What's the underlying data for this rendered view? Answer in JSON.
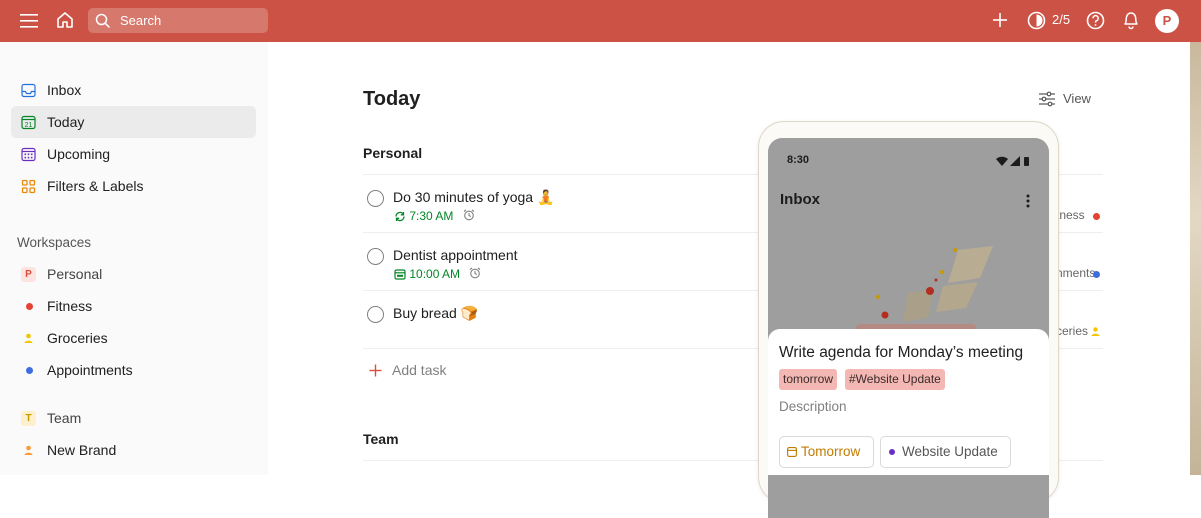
{
  "topbar": {
    "search_placeholder": "Search",
    "karma": "2/5",
    "avatar_initial": "P"
  },
  "sidebar": {
    "items": [
      {
        "label": "Inbox",
        "icon": "inbox-icon"
      },
      {
        "label": "Today",
        "icon": "calendar-today-icon",
        "day": "21"
      },
      {
        "label": "Upcoming",
        "icon": "calendar-grid-icon"
      },
      {
        "label": "Filters & Labels",
        "icon": "filters-grid-icon"
      }
    ],
    "workspaces_label": "Workspaces",
    "personal": {
      "label": "Personal",
      "initial": "P"
    },
    "projects": [
      {
        "label": "Fitness",
        "color": "#e44232"
      },
      {
        "label": "Groceries",
        "color": "#f2c500"
      },
      {
        "label": "Appointments",
        "color": "#3d6ee0"
      }
    ],
    "team": {
      "label": "Team",
      "initial": "T"
    },
    "team_projects": [
      {
        "label": "New Brand",
        "color": "#ff9a33"
      }
    ]
  },
  "main": {
    "title": "Today",
    "view_label": "View",
    "section_personal": "Personal",
    "tasks": [
      {
        "title": "Do 30 minutes of yoga 🧘",
        "time": "7:30 AM",
        "project": "tness",
        "project_color": "#e44232"
      },
      {
        "title": "Dentist appointment",
        "time": "10:00 AM",
        "project": "nments",
        "project_color": "#3d6ee0"
      },
      {
        "title": "Buy bread 🍞",
        "time": "",
        "project": "ceries",
        "project_color": "#f2c500"
      }
    ],
    "add_task": "Add task",
    "section_team": "Team"
  },
  "phone": {
    "time": "8:30",
    "screen_title": "Inbox",
    "sheet_title": "Write agenda for Monday’s meeting",
    "chips": [
      "tomorrow",
      "#Website Update"
    ],
    "description_placeholder": "Description",
    "pill_date": "Tomorrow",
    "pill_project": "Website Update"
  },
  "colors": {
    "accent": "#cc5245",
    "green": "#058527",
    "date_orange": "#c07b00"
  }
}
